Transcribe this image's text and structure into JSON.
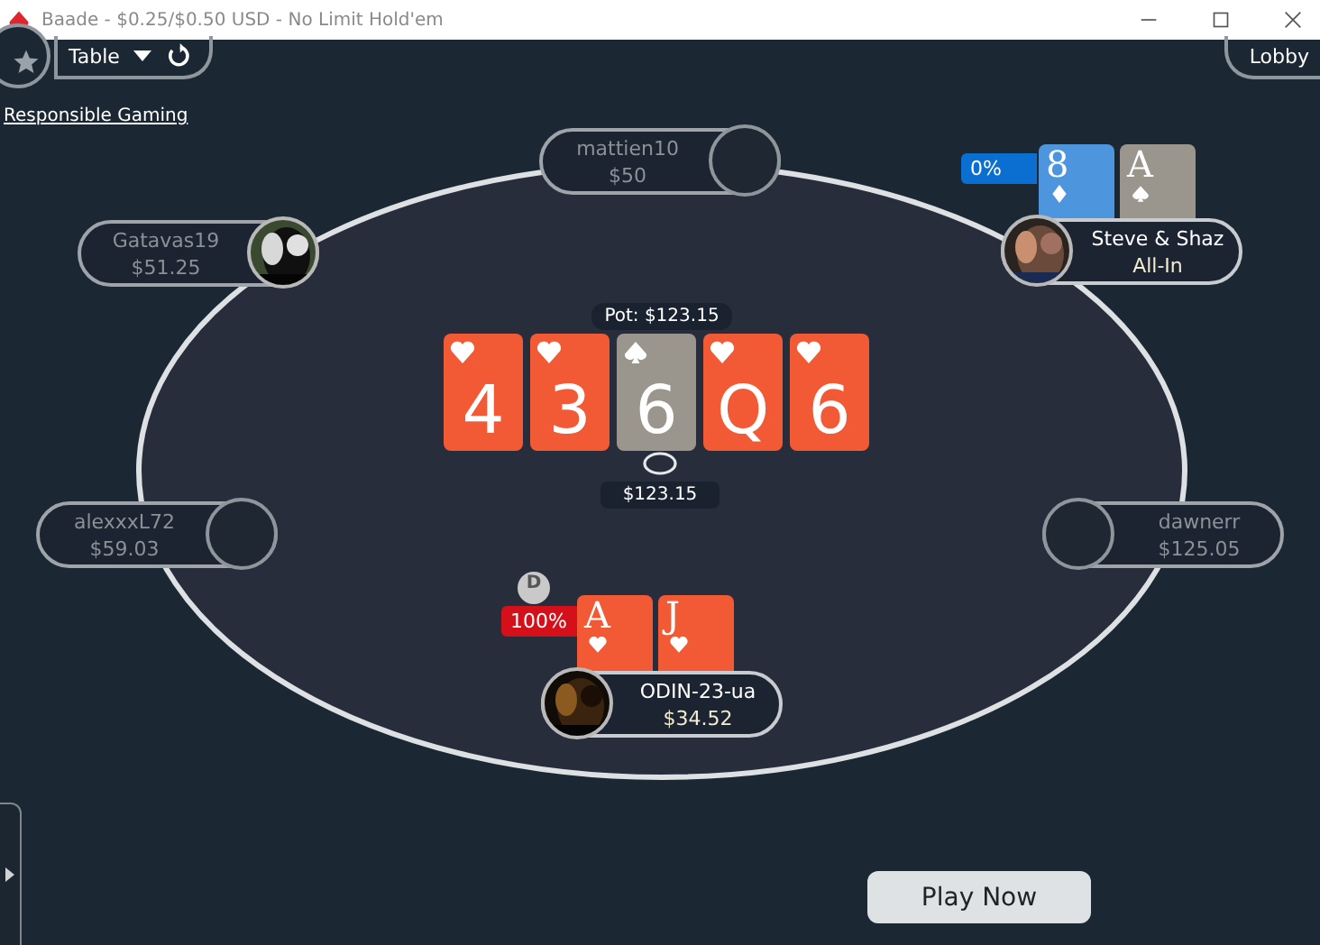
{
  "window": {
    "title": "Baade - $0.25/$0.50 USD - No Limit Hold'em"
  },
  "toolbar": {
    "table_menu": "Table",
    "lobby": "Lobby"
  },
  "responsible_gaming": "Responsible Gaming",
  "pot": {
    "label": "Pot: $123.15",
    "amount": "$123.15"
  },
  "board": [
    {
      "rank": "4",
      "kind": "hearts"
    },
    {
      "rank": "3",
      "kind": "hearts"
    },
    {
      "rank": "6",
      "kind": "spades"
    },
    {
      "rank": "Q",
      "kind": "hearts"
    },
    {
      "rank": "6",
      "kind": "hearts"
    }
  ],
  "seats": [
    {
      "name": "mattien10",
      "stack": "$50",
      "has_photo": false,
      "active": false
    },
    {
      "name": "Gatavas19",
      "stack": "$51.25",
      "has_photo": true,
      "active": false
    },
    {
      "name": "Steve & Shaz",
      "stack": "All-In",
      "has_photo": true,
      "active": true,
      "equity": {
        "text": "0%",
        "color": "#0a6fd0"
      },
      "cards": [
        {
          "rank": "8",
          "kind": "diamonds"
        },
        {
          "rank": "A",
          "kind": "spades"
        }
      ]
    },
    {
      "name": "alexxxL72",
      "stack": "$59.03",
      "has_photo": false,
      "active": false
    },
    {
      "name": "dawnerr",
      "stack": "$125.05",
      "has_photo": false,
      "active": false
    },
    {
      "name": "ODIN-23-ua",
      "stack": "$34.52",
      "has_photo": true,
      "active": true,
      "dealer": "D",
      "equity": {
        "text": "100%",
        "color": "#d4101a"
      },
      "cards": [
        {
          "rank": "A",
          "kind": "hearts"
        },
        {
          "rank": "J",
          "kind": "hearts"
        }
      ]
    }
  ],
  "play_now": "Play Now"
}
